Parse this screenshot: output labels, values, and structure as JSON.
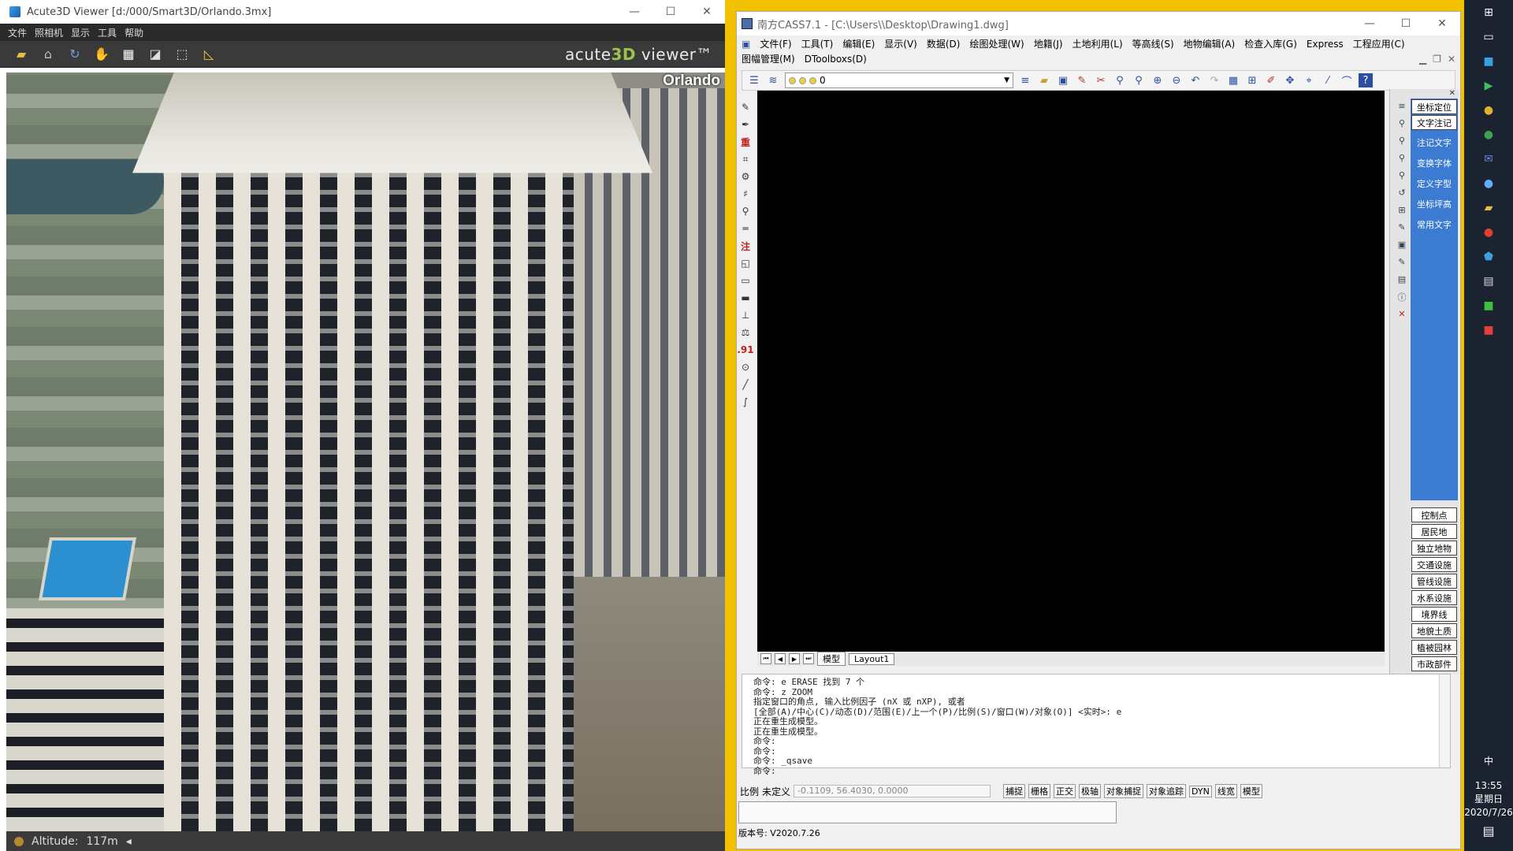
{
  "acute": {
    "title": "Acute3D Viewer [d:/000/Smart3D/Orlando.3mx]",
    "menu": [
      "文件",
      "照相机",
      "显示",
      "工具",
      "帮助"
    ],
    "brand_main": "acute",
    "brand_accent": "3D",
    "brand_tail": " viewer™",
    "scene_label": "Orlando",
    "status_altitude_label": "Altitude:",
    "status_altitude_value": "117m"
  },
  "cass": {
    "title": "南方CASS7.1 - [C:\\Users\\\\Desktop\\Drawing1.dwg]",
    "menu_row1": [
      "文件(F)",
      "工具(T)",
      "编辑(E)",
      "显示(V)",
      "数据(D)",
      "绘图处理(W)",
      "地籍(J)",
      "土地利用(L)",
      "等高线(S)",
      "地物编辑(A)",
      "检查入库(G)",
      "Express",
      "工程应用(C)"
    ],
    "menu_row2": [
      "图幅管理(M)",
      "DToolboxs(D)"
    ],
    "layer_value": "0",
    "tabs": [
      "模型",
      "Layout1"
    ],
    "right_top": [
      "坐标定位",
      "文字注记"
    ],
    "right_blue": [
      "注记文字",
      "变换字体",
      "定义字型",
      "坐标坪高",
      "常用文字"
    ],
    "right_list": [
      "控制点",
      "居民地",
      "独立地物",
      "交通设施",
      "管线设施",
      "水系设施",
      "境界线",
      "地貌土质",
      "植被园林",
      "市政部件"
    ],
    "command_lines": [
      "命令: e ERASE 找到 7 个",
      "命令: z ZOOM",
      "指定窗口的角点, 输入比例因子 (nX 或 nXP), 或者",
      "[全部(A)/中心(C)/动态(D)/范围(E)/上一个(P)/比例(S)/窗口(W)/对象(O)] <实时>: e",
      "正在重生成模型。",
      "正在重生成模型。",
      "命令:",
      "命令:",
      "命令: _qsave",
      "命令:"
    ],
    "status_scale": "比例",
    "status_undef": "未定义",
    "status_coords": "-0.1109, 56.4030, 0.0000",
    "status_toggles": [
      "捕捉",
      "栅格",
      "正交",
      "极轴",
      "对象捕捉",
      "对象追踪",
      "DYN",
      "线宽",
      "模型"
    ],
    "version": "版本号: V2020.7.26"
  },
  "taskbar": {
    "time": "13:55",
    "weekday": "星期日",
    "date": "2020/7/26",
    "ime": "中"
  }
}
